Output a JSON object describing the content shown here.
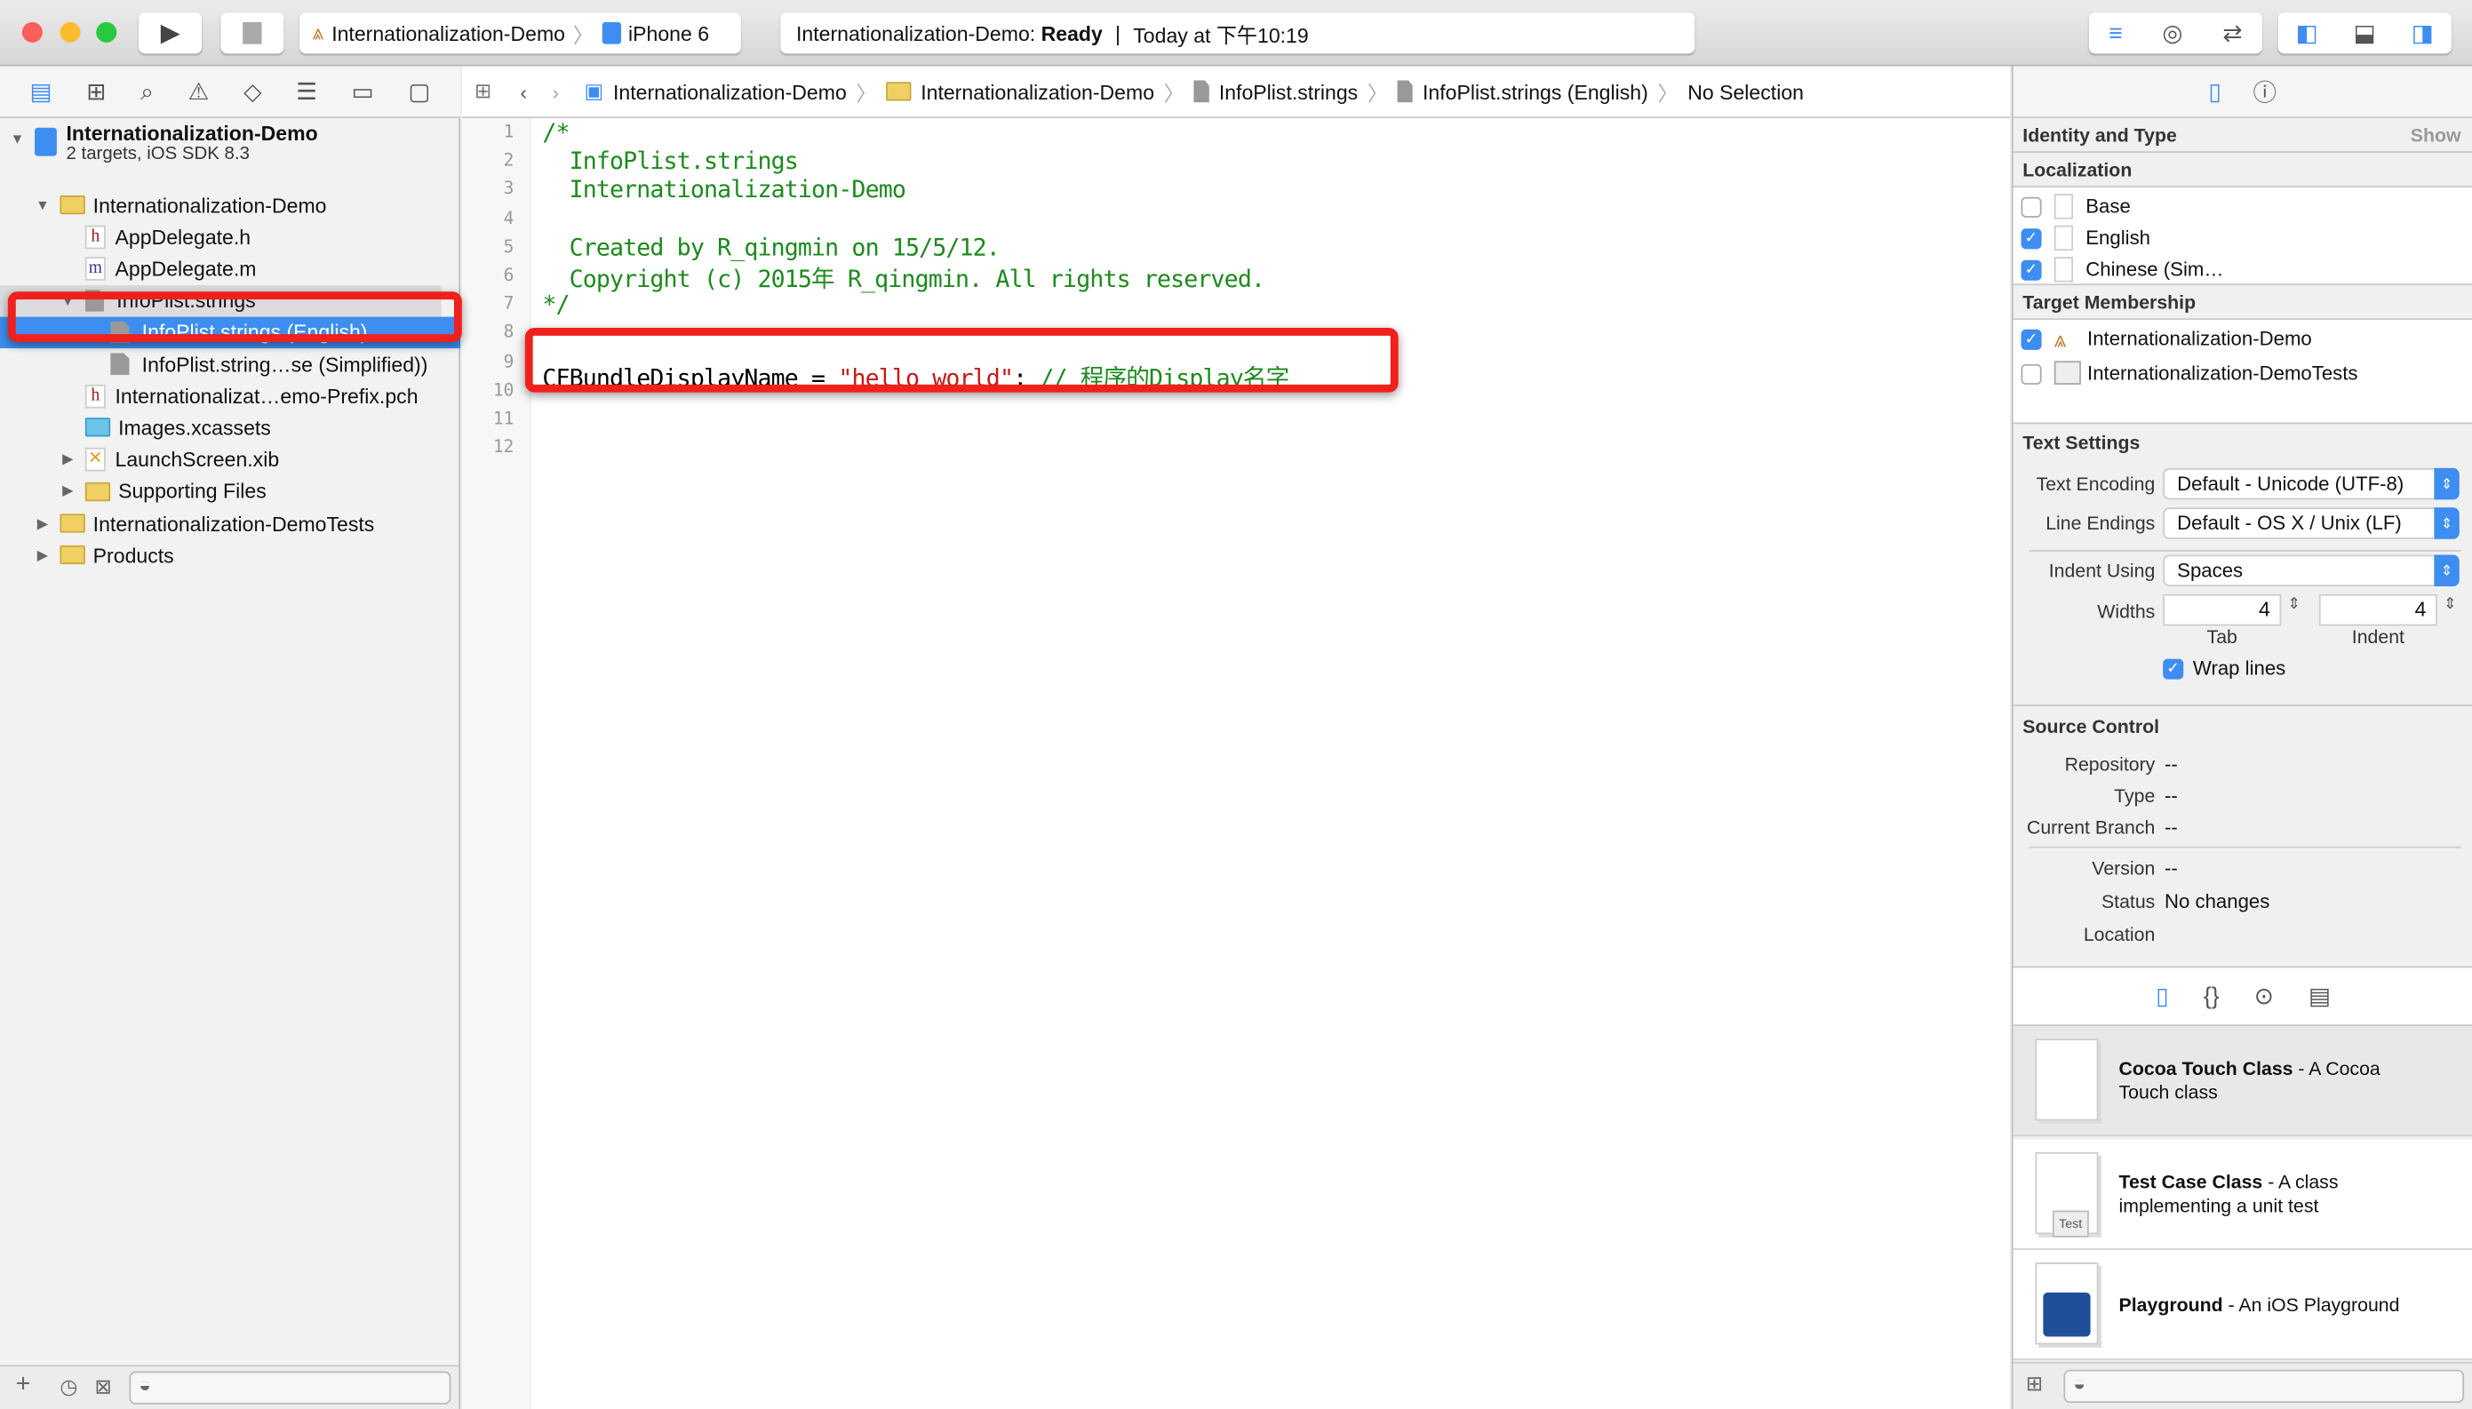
{
  "toolbar": {
    "scheme": "Internationalization-Demo",
    "device": "iPhone 6",
    "status_prefix": "Internationalization-Demo: ",
    "status_state": "Ready",
    "status_time": "Today at 下午10:19"
  },
  "jumpbar": [
    "Internationalization-Demo",
    "Internationalization-Demo",
    "InfoPlist.strings",
    "InfoPlist.strings (English)",
    "No Selection"
  ],
  "navigator": {
    "project": "Internationalization-Demo",
    "project_sub": "2 targets, iOS SDK 8.3",
    "items": [
      {
        "label": "Internationalization-Demo",
        "icon": "folder",
        "indent": 1,
        "disclosure": "open"
      },
      {
        "label": "AppDelegate.h",
        "icon": "h",
        "indent": 2,
        "disclosure": ""
      },
      {
        "label": "AppDelegate.m",
        "icon": "m",
        "indent": 2,
        "disclosure": ""
      },
      {
        "label": "InfoPlist.strings",
        "icon": "doc",
        "indent": 2,
        "disclosure": "open"
      },
      {
        "label": "InfoPlist.strings (English)",
        "icon": "doc",
        "indent": 3,
        "disclosure": "",
        "selected": true
      },
      {
        "label": "InfoPlist.string…se (Simplified))",
        "icon": "doc",
        "indent": 3,
        "disclosure": ""
      },
      {
        "label": "Internationalizat…emo-Prefix.pch",
        "icon": "h",
        "indent": 2,
        "disclosure": ""
      },
      {
        "label": "Images.xcassets",
        "icon": "assets",
        "indent": 2,
        "disclosure": ""
      },
      {
        "label": "LaunchScreen.xib",
        "icon": "xib",
        "indent": 2,
        "disclosure": "closed"
      },
      {
        "label": "Supporting Files",
        "icon": "folder",
        "indent": 2,
        "disclosure": "closed"
      },
      {
        "label": "Internationalization-DemoTests",
        "icon": "folder",
        "indent": 1,
        "disclosure": "closed"
      },
      {
        "label": "Products",
        "icon": "folder",
        "indent": 1,
        "disclosure": "closed"
      }
    ]
  },
  "editor": {
    "lines": [
      "/*",
      "  InfoPlist.strings",
      "  Internationalization-Demo",
      "",
      "  Created by R_qingmin on 15/5/12.",
      "  Copyright (c) 2015年 R_qingmin. All rights reserved.",
      "*/",
      "",
      "",
      "",
      "",
      ""
    ],
    "line9": {
      "key": "CFBundleDisplayName = ",
      "string": "\"hello world\"",
      "semi": "; ",
      "comment": "// 程序的Display名字"
    },
    "line_numbers": [
      "1",
      "2",
      "3",
      "4",
      "5",
      "6",
      "7",
      "8",
      "9",
      "10",
      "11",
      "12"
    ]
  },
  "inspector": {
    "identity": "Identity and Type",
    "show": "Show",
    "localization": "Localization",
    "locs": [
      {
        "label": "Base",
        "checked": false
      },
      {
        "label": "English",
        "checked": true
      },
      {
        "label": "Chinese (Sim…",
        "checked": true
      }
    ],
    "target_membership": "Target Membership",
    "targets": [
      {
        "label": "Internationalization-Demo",
        "checked": true
      },
      {
        "label": "Internationalization-DemoTests",
        "checked": false
      }
    ],
    "text_settings": "Text Settings",
    "text_encoding_label": "Text Encoding",
    "text_encoding": "Default - Unicode (UTF-8)",
    "line_endings_label": "Line Endings",
    "line_endings": "Default - OS X / Unix (LF)",
    "indent_using_label": "Indent Using",
    "indent_using": "Spaces",
    "widths_label": "Widths",
    "tab_width": "4",
    "indent_width": "4",
    "tab_label": "Tab",
    "indent_label": "Indent",
    "wrap_lines": "Wrap lines",
    "wrap_checked": true,
    "source_control": "Source Control",
    "sc": [
      {
        "k": "Repository",
        "v": "--"
      },
      {
        "k": "Type",
        "v": "--"
      },
      {
        "k": "Current Branch",
        "v": "--"
      },
      {
        "k": "Version",
        "v": "--"
      },
      {
        "k": "Status",
        "v": "No changes"
      },
      {
        "k": "Location",
        "v": ""
      }
    ]
  },
  "library": [
    {
      "title": "Cocoa Touch Class",
      "desc": " - A Cocoa Touch class"
    },
    {
      "title": "Test Case Class",
      "desc": " - A class implementing a unit test",
      "badge": "Test"
    },
    {
      "title": "Playground",
      "desc": " - An iOS Playground"
    }
  ],
  "colors": {
    "accent": "#3d8ef0",
    "highlight": "#f0201c",
    "comment": "#1e8a1e",
    "string": "#c41a16"
  }
}
